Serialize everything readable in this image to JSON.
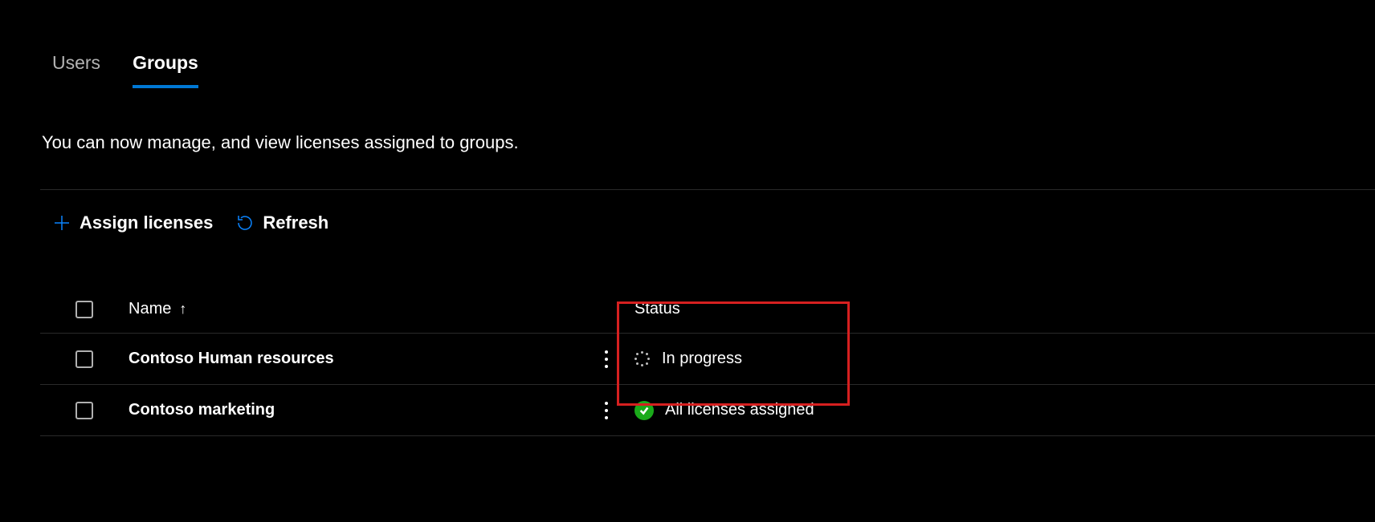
{
  "tabs": {
    "users": "Users",
    "groups": "Groups",
    "active": "groups"
  },
  "description": "You can now manage, and view licenses assigned to groups.",
  "toolbar": {
    "assign_label": "Assign licenses",
    "refresh_label": "Refresh"
  },
  "table": {
    "columns": {
      "name": "Name",
      "status": "Status"
    },
    "rows": [
      {
        "name": "Contoso Human resources",
        "status": "In progress",
        "status_kind": "progress"
      },
      {
        "name": "Contoso marketing",
        "status": "All licenses assigned",
        "status_kind": "success"
      }
    ]
  },
  "colors": {
    "accent": "#0078d4",
    "success": "#1aaa1a",
    "highlight_border": "#d62020"
  }
}
